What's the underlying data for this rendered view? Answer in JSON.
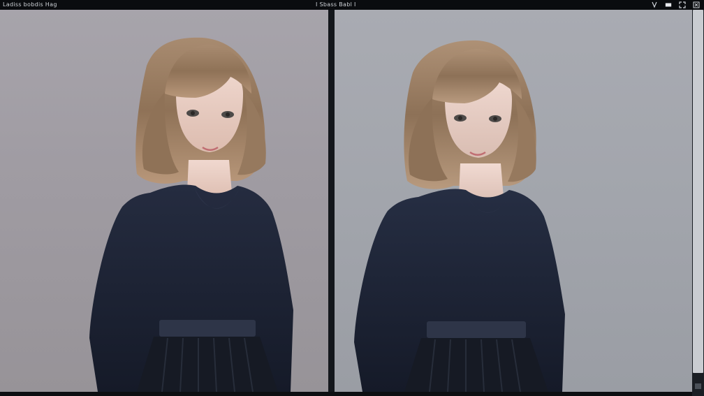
{
  "window": {
    "left_title": "Ladiss  bobdis Hag",
    "center_title": "I Sbass  Babl I",
    "controls": [
      "edit-pen-icon",
      "window-icon",
      "expand-icon",
      "close-icon"
    ]
  },
  "toolbar": {
    "tools": [
      "brush-tool-icon",
      "pencil-tool-icon",
      "dot-tool-icon",
      "dot-tool-icon",
      "dot-tool-icon",
      "dot-tool-icon",
      "dot-tool-icon",
      "dot-tool-icon",
      "dot-tool-icon",
      "dot-tool-icon",
      "dot-tool-icon",
      "dot-tool-icon"
    ]
  },
  "colors": {
    "bg_left": "#a29fa6",
    "bg_right": "#a3a6ad",
    "hair": "#9b7f66",
    "sweater": "#1f2638",
    "skin": "#e8cfc6",
    "frame": "#0d0f12"
  },
  "panels": [
    {
      "name": "original-image"
    },
    {
      "name": "edited-image"
    }
  ]
}
